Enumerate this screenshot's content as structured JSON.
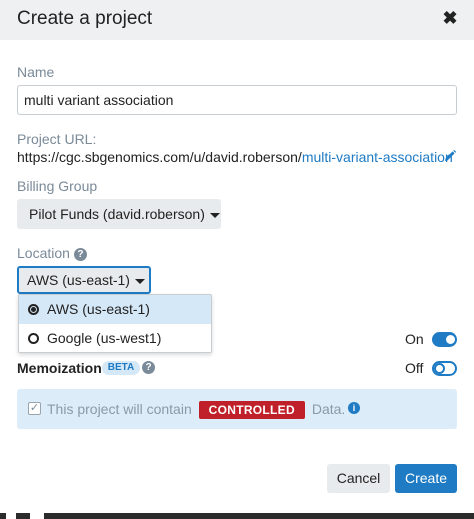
{
  "dialog": {
    "title": "Create a project",
    "close_glyph": "✖"
  },
  "name": {
    "label": "Name",
    "value": "multi variant association"
  },
  "project_url": {
    "label": "Project URL:",
    "prefix": "https://cgc.sbgenomics.com/u/david.roberson/",
    "slug": "multi-variant-association",
    "edit_icon": "pencil-icon"
  },
  "billing": {
    "label": "Billing Group",
    "selected": "Pilot Funds (david.roberson)"
  },
  "location": {
    "label": "Location",
    "selected": "AWS (us-east-1)",
    "options": [
      {
        "label": "AWS (us-east-1)",
        "selected": true
      },
      {
        "label": "Google (us-west1)",
        "selected": false
      }
    ]
  },
  "toggles": {
    "first": {
      "state_label": "On",
      "on": true
    },
    "memoization": {
      "label": "Memoization",
      "badge": "BETA",
      "state_label": "Off",
      "on": false
    }
  },
  "controlled_notice": {
    "text_before": "This project will contain",
    "badge": "CONTROLLED",
    "text_after": "Data."
  },
  "footer": {
    "cancel_label": "Cancel",
    "create_label": "Create"
  },
  "colors": {
    "accent": "#1e7bc4",
    "controlled": "#c0202a",
    "header_bg": "#eef0f1",
    "info_bg": "#dcecf8"
  }
}
